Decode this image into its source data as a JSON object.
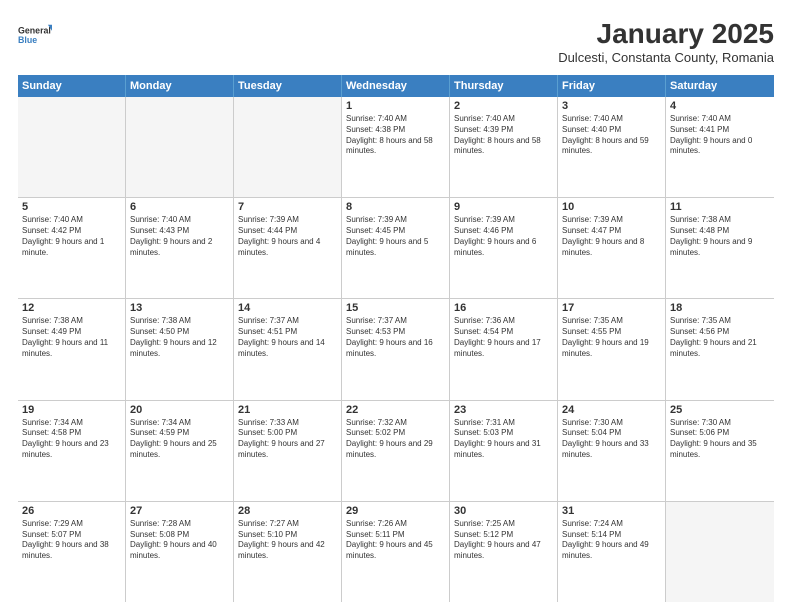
{
  "logo": {
    "general": "General",
    "blue": "Blue"
  },
  "header": {
    "month": "January 2025",
    "location": "Dulcesti, Constanta County, Romania"
  },
  "weekdays": [
    "Sunday",
    "Monday",
    "Tuesday",
    "Wednesday",
    "Thursday",
    "Friday",
    "Saturday"
  ],
  "rows": [
    [
      {
        "day": "",
        "sunrise": "",
        "sunset": "",
        "daylight": ""
      },
      {
        "day": "",
        "sunrise": "",
        "sunset": "",
        "daylight": ""
      },
      {
        "day": "",
        "sunrise": "",
        "sunset": "",
        "daylight": ""
      },
      {
        "day": "1",
        "sunrise": "Sunrise: 7:40 AM",
        "sunset": "Sunset: 4:38 PM",
        "daylight": "Daylight: 8 hours and 58 minutes."
      },
      {
        "day": "2",
        "sunrise": "Sunrise: 7:40 AM",
        "sunset": "Sunset: 4:39 PM",
        "daylight": "Daylight: 8 hours and 58 minutes."
      },
      {
        "day": "3",
        "sunrise": "Sunrise: 7:40 AM",
        "sunset": "Sunset: 4:40 PM",
        "daylight": "Daylight: 8 hours and 59 minutes."
      },
      {
        "day": "4",
        "sunrise": "Sunrise: 7:40 AM",
        "sunset": "Sunset: 4:41 PM",
        "daylight": "Daylight: 9 hours and 0 minutes."
      }
    ],
    [
      {
        "day": "5",
        "sunrise": "Sunrise: 7:40 AM",
        "sunset": "Sunset: 4:42 PM",
        "daylight": "Daylight: 9 hours and 1 minute."
      },
      {
        "day": "6",
        "sunrise": "Sunrise: 7:40 AM",
        "sunset": "Sunset: 4:43 PM",
        "daylight": "Daylight: 9 hours and 2 minutes."
      },
      {
        "day": "7",
        "sunrise": "Sunrise: 7:39 AM",
        "sunset": "Sunset: 4:44 PM",
        "daylight": "Daylight: 9 hours and 4 minutes."
      },
      {
        "day": "8",
        "sunrise": "Sunrise: 7:39 AM",
        "sunset": "Sunset: 4:45 PM",
        "daylight": "Daylight: 9 hours and 5 minutes."
      },
      {
        "day": "9",
        "sunrise": "Sunrise: 7:39 AM",
        "sunset": "Sunset: 4:46 PM",
        "daylight": "Daylight: 9 hours and 6 minutes."
      },
      {
        "day": "10",
        "sunrise": "Sunrise: 7:39 AM",
        "sunset": "Sunset: 4:47 PM",
        "daylight": "Daylight: 9 hours and 8 minutes."
      },
      {
        "day": "11",
        "sunrise": "Sunrise: 7:38 AM",
        "sunset": "Sunset: 4:48 PM",
        "daylight": "Daylight: 9 hours and 9 minutes."
      }
    ],
    [
      {
        "day": "12",
        "sunrise": "Sunrise: 7:38 AM",
        "sunset": "Sunset: 4:49 PM",
        "daylight": "Daylight: 9 hours and 11 minutes."
      },
      {
        "day": "13",
        "sunrise": "Sunrise: 7:38 AM",
        "sunset": "Sunset: 4:50 PM",
        "daylight": "Daylight: 9 hours and 12 minutes."
      },
      {
        "day": "14",
        "sunrise": "Sunrise: 7:37 AM",
        "sunset": "Sunset: 4:51 PM",
        "daylight": "Daylight: 9 hours and 14 minutes."
      },
      {
        "day": "15",
        "sunrise": "Sunrise: 7:37 AM",
        "sunset": "Sunset: 4:53 PM",
        "daylight": "Daylight: 9 hours and 16 minutes."
      },
      {
        "day": "16",
        "sunrise": "Sunrise: 7:36 AM",
        "sunset": "Sunset: 4:54 PM",
        "daylight": "Daylight: 9 hours and 17 minutes."
      },
      {
        "day": "17",
        "sunrise": "Sunrise: 7:35 AM",
        "sunset": "Sunset: 4:55 PM",
        "daylight": "Daylight: 9 hours and 19 minutes."
      },
      {
        "day": "18",
        "sunrise": "Sunrise: 7:35 AM",
        "sunset": "Sunset: 4:56 PM",
        "daylight": "Daylight: 9 hours and 21 minutes."
      }
    ],
    [
      {
        "day": "19",
        "sunrise": "Sunrise: 7:34 AM",
        "sunset": "Sunset: 4:58 PM",
        "daylight": "Daylight: 9 hours and 23 minutes."
      },
      {
        "day": "20",
        "sunrise": "Sunrise: 7:34 AM",
        "sunset": "Sunset: 4:59 PM",
        "daylight": "Daylight: 9 hours and 25 minutes."
      },
      {
        "day": "21",
        "sunrise": "Sunrise: 7:33 AM",
        "sunset": "Sunset: 5:00 PM",
        "daylight": "Daylight: 9 hours and 27 minutes."
      },
      {
        "day": "22",
        "sunrise": "Sunrise: 7:32 AM",
        "sunset": "Sunset: 5:02 PM",
        "daylight": "Daylight: 9 hours and 29 minutes."
      },
      {
        "day": "23",
        "sunrise": "Sunrise: 7:31 AM",
        "sunset": "Sunset: 5:03 PM",
        "daylight": "Daylight: 9 hours and 31 minutes."
      },
      {
        "day": "24",
        "sunrise": "Sunrise: 7:30 AM",
        "sunset": "Sunset: 5:04 PM",
        "daylight": "Daylight: 9 hours and 33 minutes."
      },
      {
        "day": "25",
        "sunrise": "Sunrise: 7:30 AM",
        "sunset": "Sunset: 5:06 PM",
        "daylight": "Daylight: 9 hours and 35 minutes."
      }
    ],
    [
      {
        "day": "26",
        "sunrise": "Sunrise: 7:29 AM",
        "sunset": "Sunset: 5:07 PM",
        "daylight": "Daylight: 9 hours and 38 minutes."
      },
      {
        "day": "27",
        "sunrise": "Sunrise: 7:28 AM",
        "sunset": "Sunset: 5:08 PM",
        "daylight": "Daylight: 9 hours and 40 minutes."
      },
      {
        "day": "28",
        "sunrise": "Sunrise: 7:27 AM",
        "sunset": "Sunset: 5:10 PM",
        "daylight": "Daylight: 9 hours and 42 minutes."
      },
      {
        "day": "29",
        "sunrise": "Sunrise: 7:26 AM",
        "sunset": "Sunset: 5:11 PM",
        "daylight": "Daylight: 9 hours and 45 minutes."
      },
      {
        "day": "30",
        "sunrise": "Sunrise: 7:25 AM",
        "sunset": "Sunset: 5:12 PM",
        "daylight": "Daylight: 9 hours and 47 minutes."
      },
      {
        "day": "31",
        "sunrise": "Sunrise: 7:24 AM",
        "sunset": "Sunset: 5:14 PM",
        "daylight": "Daylight: 9 hours and 49 minutes."
      },
      {
        "day": "",
        "sunrise": "",
        "sunset": "",
        "daylight": ""
      }
    ]
  ]
}
